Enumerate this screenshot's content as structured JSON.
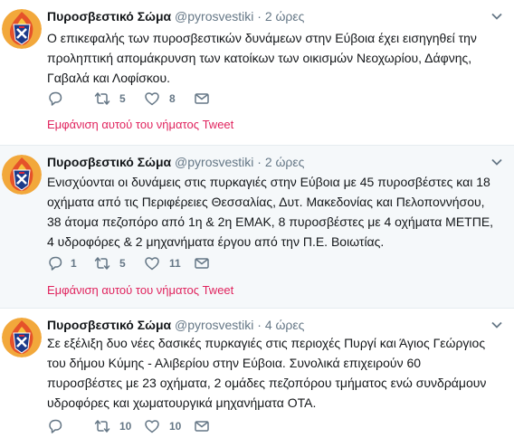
{
  "tweets": [
    {
      "name": "Πυροσβεστικό Σώμα",
      "handle": "@pyrosvestiki",
      "time": "· 2 ώρες",
      "text": "Ο επικεφαλής των πυροσβεστικών δυνάμεων στην Εύβοια έχει εισηγηθεί  την\nπροληπτική απομάκρυνση των κατοίκων των οικισμών Νεοχωρίου, Δάφνης,\nΓαβαλά και Λοφίσκου.",
      "reply_count": "",
      "retweet_count": "5",
      "like_count": "8",
      "show_thread": "Εμφάνιση αυτού του νήματος Tweet"
    },
    {
      "name": "Πυροσβεστικό Σώμα",
      "handle": "@pyrosvestiki",
      "time": "· 2 ώρες",
      "text": "Ενισχύονται οι δυνάμεις στις  πυρκαγιές στην Εύβοια με 45 πυροσβέστες και 18\nοχήματα από τις Περιφέρειες Θεσσαλίας, Δυτ. Μακεδονίας και Πελοποννήσου,\n38 άτομα πεζοπόρο από 1η & 2η ΕΜΑΚ, 8 πυροσβέστες με 4 οχήματα ΜΕΤΠΕ,\n4 υδροφόρες & 2 μηχανήματα έργου από την Π.Ε. Βοιωτίας.",
      "reply_count": "1",
      "retweet_count": "5",
      "like_count": "11",
      "show_thread": "Εμφάνιση αυτού του νήματος Tweet"
    },
    {
      "name": "Πυροσβεστικό Σώμα",
      "handle": "@pyrosvestiki",
      "time": "· 4 ώρες",
      "text": "Σε εξέλιξη δυο νέες δασικές πυρκαγιές στις περιοχές Πυργί και Άγιος Γεώργιος\nτου δήμου Κύμης - Αλιβερίου στην Εύβοια. Συνολικά επιχειρούν 60\nπυροσβέστες με 23 οχήματα, 2 ομάδες πεζοπόρου τμήματος ενώ συνδράμουν\nυδροφόρες και χωματουργικά μηχανήματα ΟΤΑ.",
      "reply_count": "",
      "retweet_count": "10",
      "like_count": "10"
    }
  ],
  "colors": {
    "text": "#14171a",
    "muted": "#657786",
    "link": "#e0245e",
    "highlight_bg": "#f5f8fa",
    "divider": "#e6ecf0"
  },
  "icons": [
    "avatar-fire-service-logo",
    "chevron-down-icon",
    "reply-icon",
    "retweet-icon",
    "like-icon",
    "message-icon"
  ]
}
